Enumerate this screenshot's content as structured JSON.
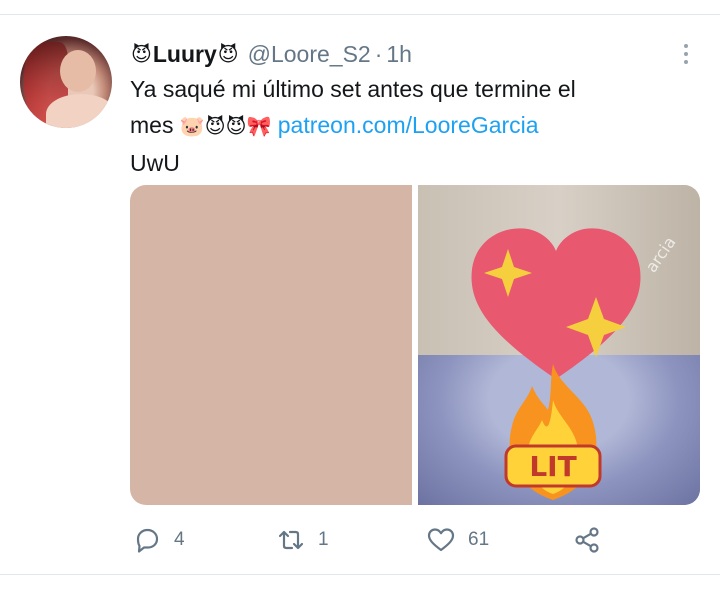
{
  "tweet": {
    "author": {
      "display_name": "Luury",
      "name_emoji_before": "😈",
      "name_emoji_after": "😈",
      "handle": "@Loore_S2",
      "separator": "·",
      "time": "1h"
    },
    "text": {
      "line1": "Ya saqué mi último set antes que termine el",
      "line2_prefix": "mes",
      "line2_emojis": "🐷😈😈🎀",
      "link": "patreon.com/LooreGarcia",
      "line3": "UwU"
    },
    "media": {
      "watermark": "arcia",
      "sticker_text": "LIT"
    },
    "actions": {
      "reply_count": "4",
      "retweet_count": "1",
      "like_count": "61"
    },
    "icons": {
      "reply": "reply-icon",
      "retweet": "retweet-icon",
      "like": "heart-icon",
      "share": "share-icon",
      "more": "more-icon"
    },
    "colors": {
      "link": "#1da1f2",
      "muted": "#657786",
      "text": "#14171a"
    }
  }
}
